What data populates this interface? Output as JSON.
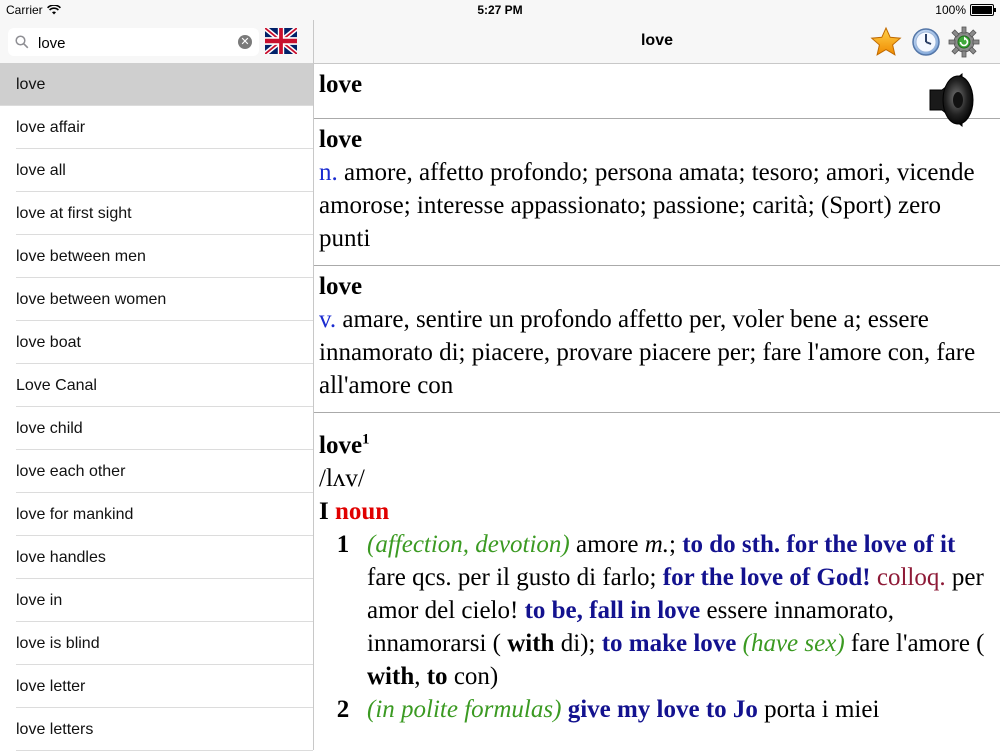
{
  "status": {
    "carrier": "Carrier",
    "time": "5:27 PM",
    "battery": "100%"
  },
  "search": {
    "value": "love",
    "clear_label": "✕"
  },
  "wordlist": [
    "love",
    "love affair",
    "love all",
    "love at first sight",
    "love between men",
    "love between women",
    "love boat",
    "Love Canal",
    "love child",
    "love each other",
    "love for mankind",
    "love handles",
    "love in",
    "love is blind",
    "love letter",
    "love letters"
  ],
  "header": {
    "title": "love"
  },
  "entries": {
    "e1": {
      "headword": "love"
    },
    "e2": {
      "headword": "love",
      "pos": "n.",
      "text": "amore, affetto profondo; persona amata; tesoro; amori, vicende amorose; interesse appassionato; passione; carità; (Sport) zero punti"
    },
    "e3": {
      "headword": "love",
      "pos": "v.",
      "text": "amare, sentire un profondo affetto per, voler bene a; essere innamorato di; piacere, provare piacere per; fare l'amore con, fare all'amore con"
    },
    "e4": {
      "headword": "love",
      "sup": "1",
      "phonetic": "/lʌv/",
      "roman": "I",
      "pos": "noun",
      "sense1": {
        "num": "1",
        "t1": "(affection, devotion)",
        "t2": " amore ",
        "t3": "m.",
        "t4": "; ",
        "t5": "to do sth. for the love of it",
        "t6": " fare qcs. per il gusto di farlo; ",
        "t7": "for the love of God!",
        "t8": " ",
        "t9": "colloq.",
        "t10": " per amor del cielo! ",
        "t11": "to be, fall in love",
        "t12": " essere innamorato, innamorarsi ( ",
        "t13": "with",
        "t14": " di); ",
        "t15": "to make love",
        "t16": " ",
        "t17": "(have sex)",
        "t18": " fare l'amore ( ",
        "t19": "with",
        "t20": ", ",
        "t21": "to",
        "t22": " con)"
      },
      "sense2": {
        "num": "2",
        "t1": "(in polite formulas)",
        "t2": " ",
        "t3": "give my love to Jo",
        "t4": " porta i miei"
      }
    }
  }
}
